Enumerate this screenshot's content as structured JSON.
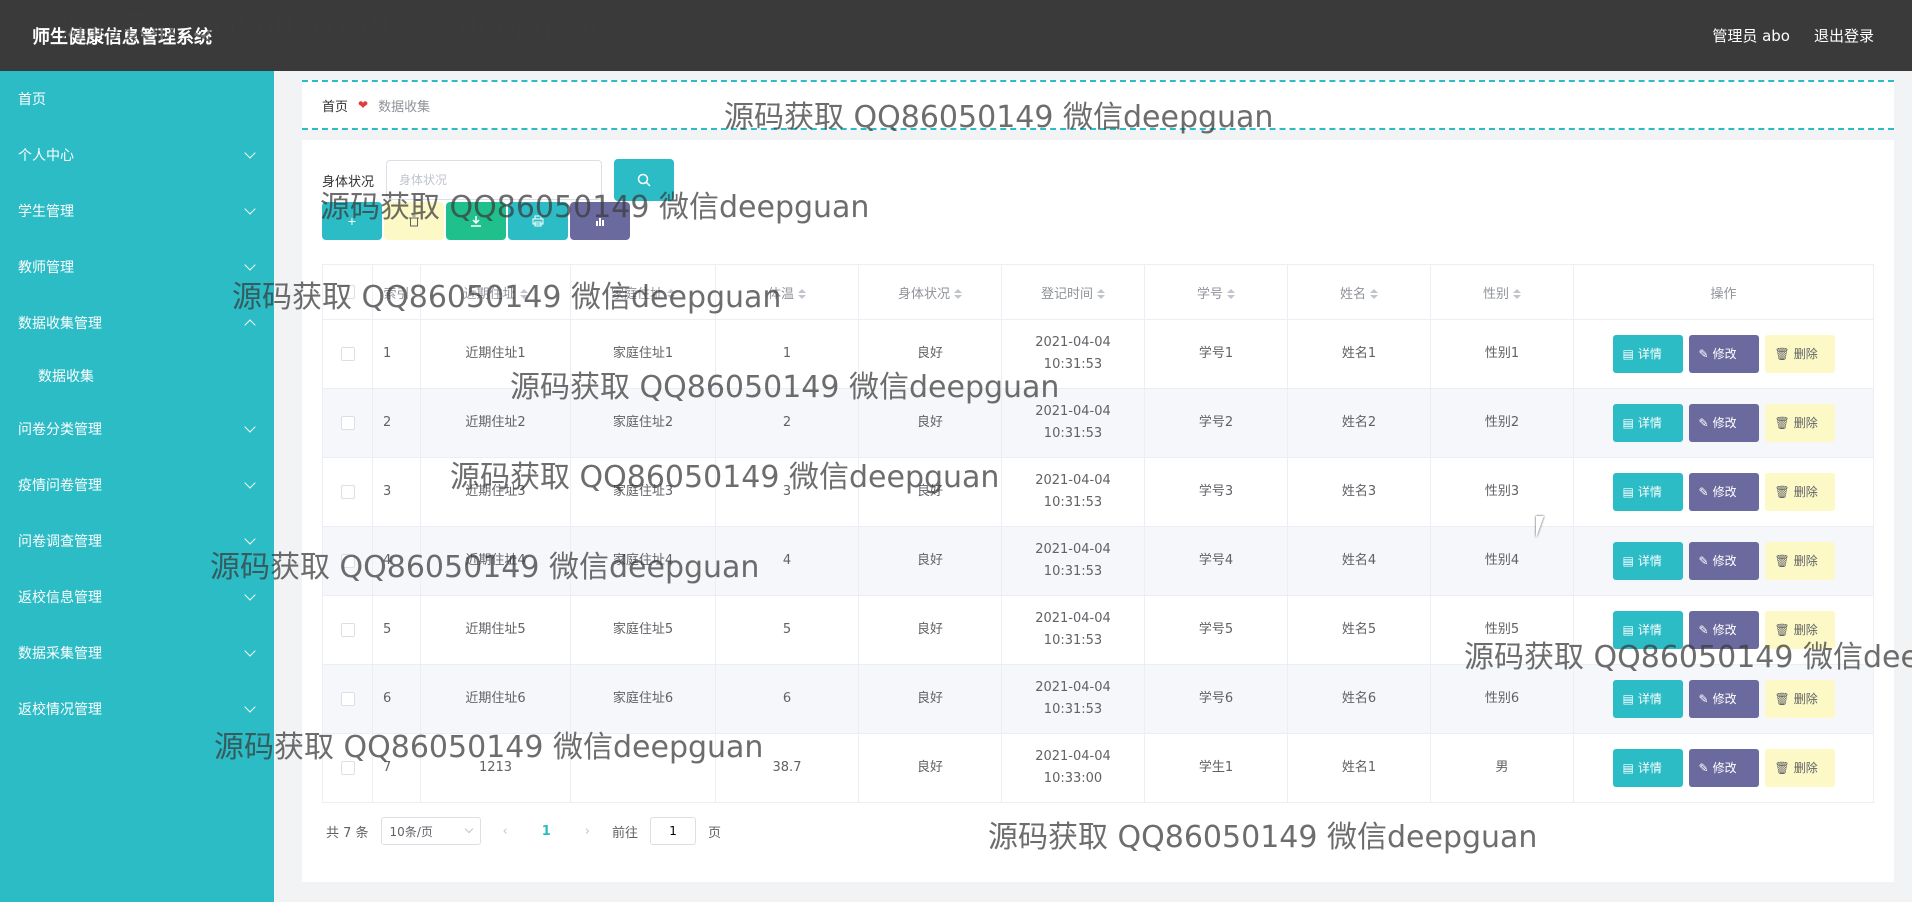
{
  "header": {
    "title": "师生健康信息管理系统",
    "user": "管理员 abo",
    "logout": "退出登录"
  },
  "sidebar": {
    "items": [
      {
        "label": "首页",
        "arrow": ""
      },
      {
        "label": "个人中心",
        "arrow": "down"
      },
      {
        "label": "学生管理",
        "arrow": "down"
      },
      {
        "label": "教师管理",
        "arrow": "down"
      },
      {
        "label": "数据收集管理",
        "arrow": "up"
      },
      {
        "label": "数据收集",
        "arrow": "",
        "sub": true
      },
      {
        "label": "问卷分类管理",
        "arrow": "down"
      },
      {
        "label": "疫情问卷管理",
        "arrow": "down"
      },
      {
        "label": "问卷调查管理",
        "arrow": "down"
      },
      {
        "label": "返校信息管理",
        "arrow": "down"
      },
      {
        "label": "数据采集管理",
        "arrow": "down"
      },
      {
        "label": "返校情况管理",
        "arrow": "down"
      }
    ]
  },
  "breadcrumb": {
    "home": "首页",
    "sep": "❤",
    "current": "数据收集"
  },
  "search": {
    "label": "身体状况",
    "placeholder": "身体状况",
    "value": ""
  },
  "table": {
    "headers": [
      "索引",
      "近期住址",
      "家庭住址",
      "体温",
      "身体状况",
      "登记时间",
      "学号",
      "姓名",
      "性别",
      "操作"
    ],
    "rows": [
      [
        "1",
        "近期住址1",
        "家庭住址1",
        "1",
        "良好",
        "2021-04-04 10:31:53",
        "学号1",
        "姓名1",
        "性别1"
      ],
      [
        "2",
        "近期住址2",
        "家庭住址2",
        "2",
        "良好",
        "2021-04-04 10:31:53",
        "学号2",
        "姓名2",
        "性别2"
      ],
      [
        "3",
        "近期住址3",
        "家庭住址3",
        "3",
        "良好",
        "2021-04-04 10:31:53",
        "学号3",
        "姓名3",
        "性别3"
      ],
      [
        "4",
        "近期住址4",
        "家庭住址4",
        "4",
        "良好",
        "2021-04-04 10:31:53",
        "学号4",
        "姓名4",
        "性别4"
      ],
      [
        "5",
        "近期住址5",
        "家庭住址5",
        "5",
        "良好",
        "2021-04-04 10:31:53",
        "学号5",
        "姓名5",
        "性别5"
      ],
      [
        "6",
        "近期住址6",
        "家庭住址6",
        "6",
        "良好",
        "2021-04-04 10:31:53",
        "学号6",
        "姓名6",
        "性别6"
      ],
      [
        "7",
        "1213",
        "",
        "38.7",
        "良好",
        "2021-04-04 10:33:00",
        "学生1",
        "姓名1",
        "男"
      ]
    ],
    "actions": {
      "detail": "详情",
      "edit": "修改",
      "delete": "删除"
    }
  },
  "pager": {
    "total": "共 7 条",
    "size": "10条/页",
    "current": "1",
    "goto_prefix": "前往",
    "goto_value": "1",
    "goto_suffix": "页"
  },
  "watermark": "源码获取 QQ86050149 微信deepguan",
  "colors": {
    "primary": "#2bbcc6",
    "topbar": "#3a3a3a",
    "edit": "#6b6a9e",
    "delete": "#fcf9c6",
    "export": "#20c08c"
  }
}
